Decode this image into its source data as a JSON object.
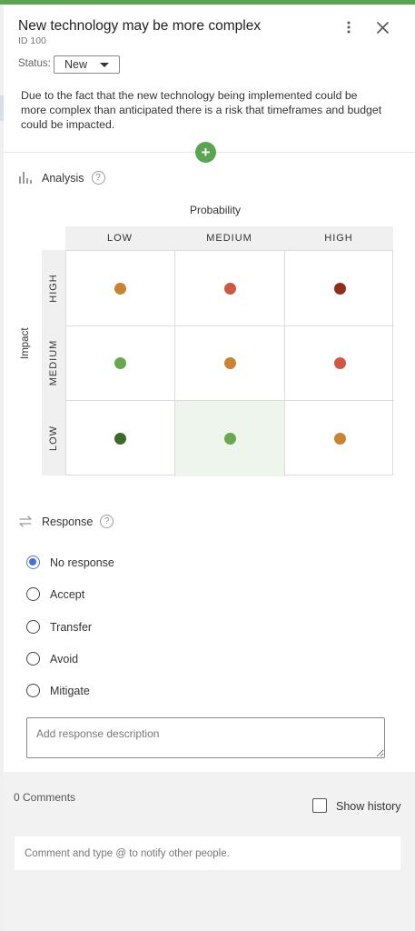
{
  "risk": {
    "title": "New technology may be more complex",
    "id_label": "ID 100",
    "status_label": "Status:",
    "status_value": "New",
    "description": "Due to the fact that the new technology being implemented could be more complex than anticipated there is a risk that timeframes and budget could be impacted."
  },
  "icons": {
    "kebab": "more-vertical-icon",
    "close": "close-icon",
    "add": "plus-icon",
    "analysis": "bar-chart-icon",
    "response": "swap-arrows-icon",
    "help": "question-icon"
  },
  "analysis": {
    "heading": "Analysis",
    "help_glyph": "?",
    "probability_label": "Probability",
    "impact_label": "Impact",
    "columns": [
      "LOW",
      "MEDIUM",
      "HIGH"
    ],
    "rows": [
      "HIGH",
      "MEDIUM",
      "LOW"
    ],
    "cell_colors": [
      [
        "#c98332",
        "#cf5844",
        "#8f2f1a"
      ],
      [
        "#6aa84f",
        "#c98332",
        "#cf5844"
      ],
      [
        "#3c6a2c",
        "#6aa84f",
        "#c98332"
      ]
    ],
    "selected": {
      "impact": "LOW",
      "probability": "MEDIUM"
    }
  },
  "response": {
    "heading": "Response",
    "help_glyph": "?",
    "options": [
      "No response",
      "Accept",
      "Transfer",
      "Avoid",
      "Mitigate"
    ],
    "selected": "No response",
    "description_placeholder": "Add response description"
  },
  "comments": {
    "count_label": "0 Comments",
    "show_history_label": "Show history",
    "input_placeholder": "Comment and type @ to notify other people."
  },
  "colors": {
    "accent_green": "#5aa552",
    "radio_blue": "#4a6ed6"
  }
}
